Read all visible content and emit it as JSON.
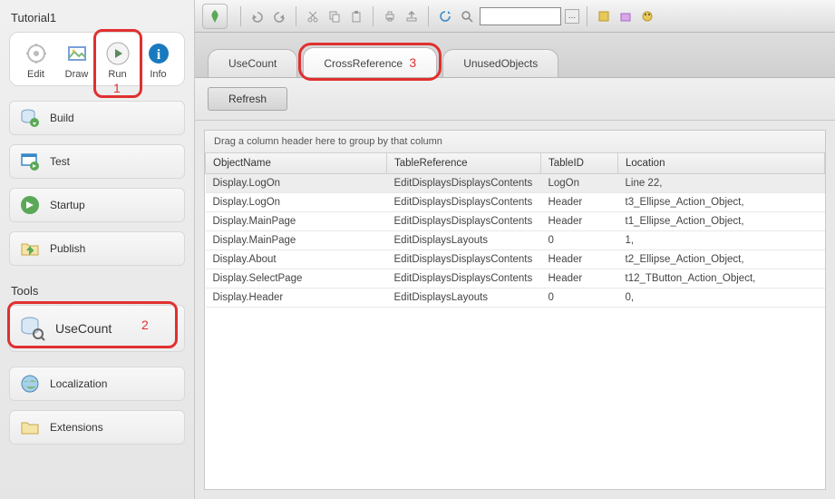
{
  "sidebar": {
    "title": "Tutorial1",
    "top_icons": [
      {
        "label": "Edit"
      },
      {
        "label": "Draw"
      },
      {
        "label": "Run"
      },
      {
        "label": "Info"
      }
    ],
    "actions": [
      {
        "label": "Build"
      },
      {
        "label": "Test"
      },
      {
        "label": "Startup"
      },
      {
        "label": "Publish"
      }
    ],
    "tools_title": "Tools",
    "tools": [
      {
        "label": "UseCount"
      },
      {
        "label": "Localization"
      },
      {
        "label": "Extensions"
      }
    ]
  },
  "callouts": {
    "num1": "1",
    "num2": "2",
    "num3": "3"
  },
  "toolbar": {
    "search_value": "",
    "dots": "..."
  },
  "tabs": [
    {
      "label": "UseCount"
    },
    {
      "label": "CrossReference"
    },
    {
      "label": "UnusedObjects"
    }
  ],
  "refresh_label": "Refresh",
  "group_hint": "Drag a column header here to group by that column",
  "columns": {
    "object": "ObjectName",
    "ref": "TableReference",
    "tid": "TableID",
    "loc": "Location"
  },
  "rows": [
    {
      "object": "Display.LogOn",
      "ref": "EditDisplaysDisplaysContents",
      "tid": "LogOn",
      "loc": "Line 22,",
      "sel": true
    },
    {
      "object": "Display.LogOn",
      "ref": "EditDisplaysDisplaysContents",
      "tid": "Header",
      "loc": "t3_Ellipse_Action_Object,"
    },
    {
      "object": "Display.MainPage",
      "ref": "EditDisplaysDisplaysContents",
      "tid": "Header",
      "loc": "t1_Ellipse_Action_Object,"
    },
    {
      "object": "Display.MainPage",
      "ref": "EditDisplaysLayouts",
      "tid": "0",
      "loc": "1,"
    },
    {
      "object": "Display.About",
      "ref": "EditDisplaysDisplaysContents",
      "tid": "Header",
      "loc": "t2_Ellipse_Action_Object,"
    },
    {
      "object": "Display.SelectPage",
      "ref": "EditDisplaysDisplaysContents",
      "tid": "Header",
      "loc": "t12_TButton_Action_Object,"
    },
    {
      "object": "Display.Header",
      "ref": "EditDisplaysLayouts",
      "tid": "0",
      "loc": "0,"
    }
  ]
}
